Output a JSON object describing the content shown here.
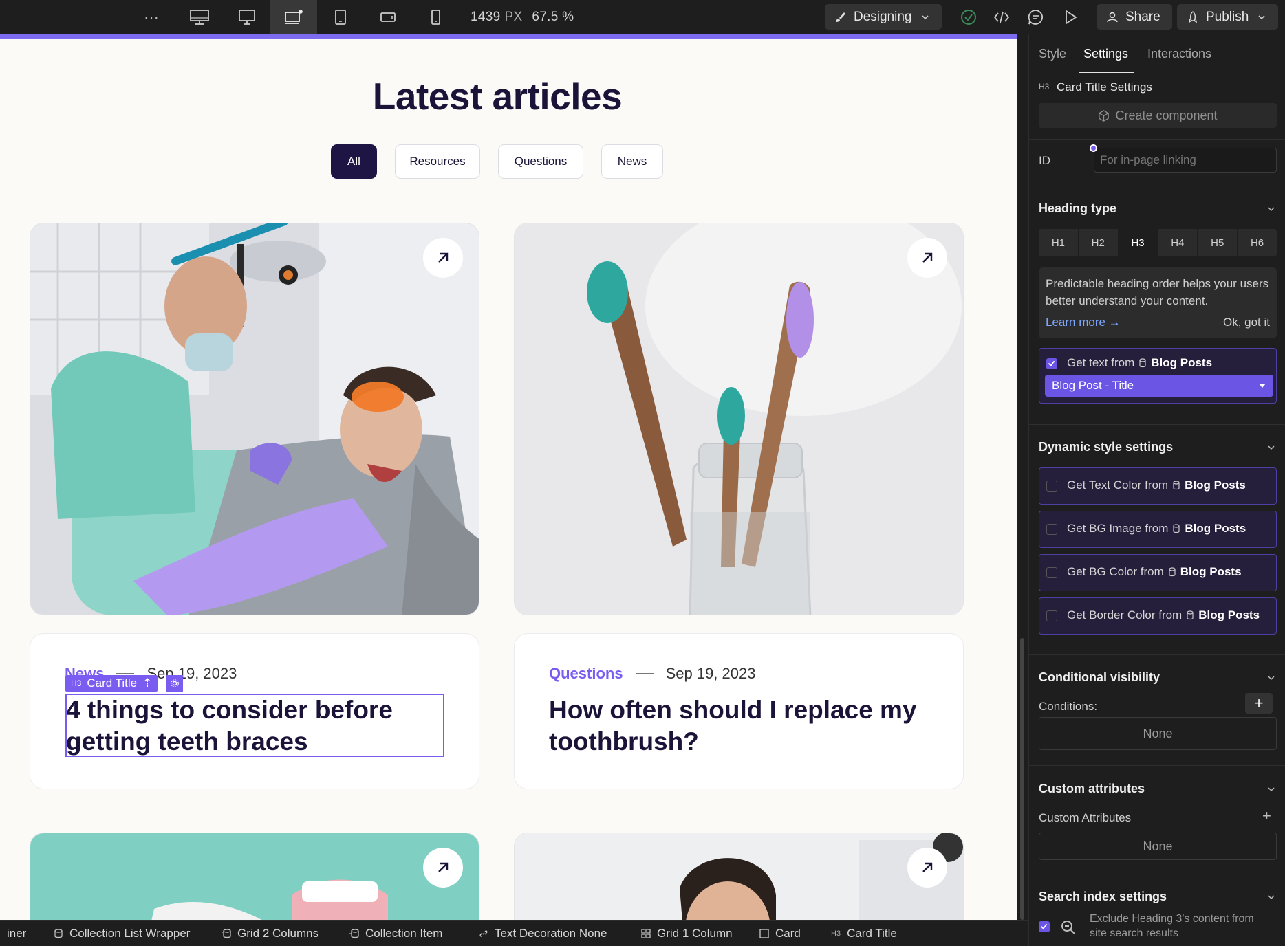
{
  "topbar": {
    "more": "···",
    "width_value": "1439",
    "width_unit": "PX",
    "zoom": "67.5 %",
    "mode_label": "Designing",
    "share_label": "Share",
    "publish_label": "Publish"
  },
  "canvas": {
    "page_title": "Latest articles",
    "filters": [
      "All",
      "Resources",
      "Questions",
      "News"
    ],
    "cards": [
      {
        "category": "News",
        "date": "Sep 19, 2023",
        "title": "4 things to consider before getting teeth braces"
      },
      {
        "category": "Questions",
        "date": "Sep 19, 2023",
        "title": "How often should I replace my toothbrush?"
      }
    ],
    "selection_label": "Card Title",
    "selection_tag": "H3"
  },
  "panel": {
    "tabs": [
      "Style",
      "Settings",
      "Interactions"
    ],
    "element_tag": "H3",
    "element_title": "Card Title Settings",
    "create_component": "Create component",
    "id_label": "ID",
    "id_placeholder": "For in-page linking",
    "heading_type_title": "Heading type",
    "heading_levels": [
      "H1",
      "H2",
      "H3",
      "H4",
      "H5",
      "H6"
    ],
    "info_text": "Predictable heading order helps your users better understand your content.",
    "learn_more": "Learn more →",
    "ok_got_it": "Ok, got it",
    "get_text_from": "Get text from",
    "collection": "Blog Posts",
    "field_selected": "Blog Post - Title",
    "dynamic_style_title": "Dynamic style settings",
    "dynamic_items": [
      "Get Text Color from",
      "Get BG Image from",
      "Get BG Color from",
      "Get Border Color from"
    ],
    "conditional_title": "Conditional visibility",
    "conditions_label": "Conditions:",
    "none": "None",
    "custom_attr_title": "Custom attributes",
    "custom_attr_label": "Custom Attributes",
    "search_title": "Search index settings",
    "search_text": "Exclude Heading 3's content from site search results"
  },
  "breadcrumbs": [
    "iner",
    "Collection List Wrapper",
    "Grid 2 Columns",
    "Collection Item",
    "Text Decoration None",
    "Grid 1 Column",
    "Card",
    "Card Title"
  ],
  "colors": {
    "accent": "#7a5cf0",
    "navy": "#1b1338",
    "canvas_bg": "#fbfaf6"
  }
}
